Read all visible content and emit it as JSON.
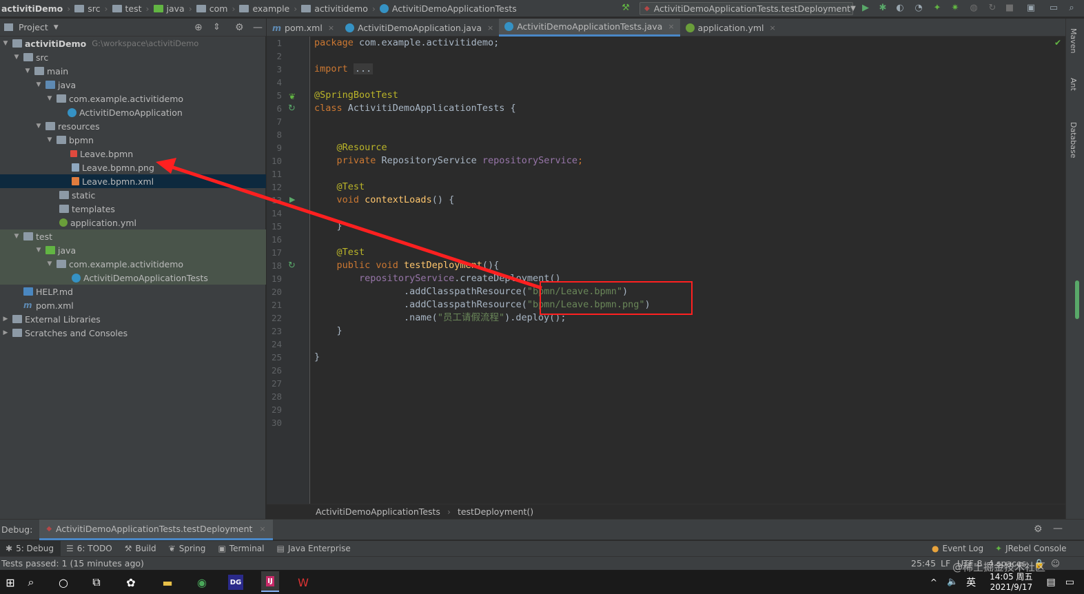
{
  "navbar": {
    "crumbs": [
      "activitiDemo",
      "src",
      "test",
      "java",
      "com",
      "example",
      "activitidemo",
      "ActivitiDemoApplicationTests"
    ],
    "run_config": "ActivitiDemoApplicationTests.testDeployment"
  },
  "project_panel": {
    "title": "Project",
    "tree": [
      {
        "label": "activitiDemo",
        "extra": "G:\\workspace\\activitiDemo"
      },
      {
        "label": "src"
      },
      {
        "label": "main"
      },
      {
        "label": "java"
      },
      {
        "label": "com.example.activitidemo"
      },
      {
        "label": "ActivitiDemoApplication"
      },
      {
        "label": "resources"
      },
      {
        "label": "bpmn"
      },
      {
        "label": "Leave.bpmn"
      },
      {
        "label": "Leave.bpmn.png"
      },
      {
        "label": "Leave.bpmn.xml"
      },
      {
        "label": "static"
      },
      {
        "label": "templates"
      },
      {
        "label": "application.yml"
      },
      {
        "label": "test"
      },
      {
        "label": "java"
      },
      {
        "label": "com.example.activitidemo"
      },
      {
        "label": "ActivitiDemoApplicationTests"
      },
      {
        "label": "HELP.md"
      },
      {
        "label": "pom.xml"
      },
      {
        "label": "External Libraries"
      },
      {
        "label": "Scratches and Consoles"
      }
    ]
  },
  "editor": {
    "tabs": [
      {
        "label": "pom.xml"
      },
      {
        "label": "ActivitiDemoApplication.java"
      },
      {
        "label": "ActivitiDemoApplicationTests.java"
      },
      {
        "label": "application.yml"
      }
    ],
    "line_numbers": [
      "1",
      "2",
      "3",
      "4",
      "5",
      "6",
      "7",
      "8",
      "9",
      "10",
      "11",
      "12",
      "13",
      "14",
      "15",
      "16",
      "17",
      "18",
      "19",
      "20",
      "21",
      "22",
      "23",
      "24",
      "25",
      "26",
      "27",
      "28",
      "29",
      "30"
    ],
    "code": {
      "l1_kw": "package",
      "l1_rest": " com.example.activitidemo;",
      "l3_kw": "import",
      "l3_fold": "...",
      "l9": "@SpringBootTest",
      "l10_kw": "class",
      "l10_rest": " ActivitiDemoApplicationTests {",
      "l13": "    @Resource",
      "l14_kw": "    private",
      "l14_type": " RepositoryService ",
      "l14_fld": "repositoryService",
      "l14_end": ";",
      "l16": "    @Test",
      "l17_kw": "    void",
      "l17_fn": " contextLoads",
      "l17_end": "() {",
      "l19": "    }",
      "l21": "    @Test",
      "l22_kw": "    public void",
      "l22_fn": " testDeployment",
      "l22_end": "(){",
      "l23_fld": "        repositoryService",
      "l23_rest": ".createDeployment()",
      "l24_a": "                .addClasspathResource(",
      "l24_str": "\"bpmn/Leave.bpmn\"",
      "l24_b": ")",
      "l25_a": "                .addClasspathResource(",
      "l25_str": "\"bpmn/Leave.bpmn.png\"",
      "l25_b": ")",
      "l26_a": "                .name(",
      "l26_str": "\"员工请假流程\"",
      "l26_b": ").deploy();",
      "l27": "    }",
      "l29": "}"
    },
    "breadcrumbs": [
      "ActivitiDemoApplicationTests",
      "testDeployment()"
    ]
  },
  "right_strip": [
    "Maven",
    "Ant",
    "Database"
  ],
  "debug": {
    "label": "Debug:",
    "session": "ActivitiDemoApplicationTests.testDeployment"
  },
  "tool_tabs": [
    {
      "label": "5: Debug"
    },
    {
      "label": "6: TODO"
    },
    {
      "label": "Build"
    },
    {
      "label": "Spring"
    },
    {
      "label": "Terminal"
    },
    {
      "label": "Java Enterprise"
    }
  ],
  "tool_tabs_right": [
    {
      "label": "Event Log"
    },
    {
      "label": "JRebel Console"
    }
  ],
  "status": {
    "message": "Tests passed: 1 (15 minutes ago)",
    "position": "25:45",
    "line_sep": "LF",
    "encoding": "UTF-8",
    "indent": "4 spaces"
  },
  "taskbar": {
    "lang": "英",
    "time": "14:05 周五",
    "date": "2021/9/17",
    "watermark": "@稀土掘金技术社区"
  },
  "colors": {
    "annotation_red": "#ff2020",
    "accent_blue": "#4a88c7"
  }
}
